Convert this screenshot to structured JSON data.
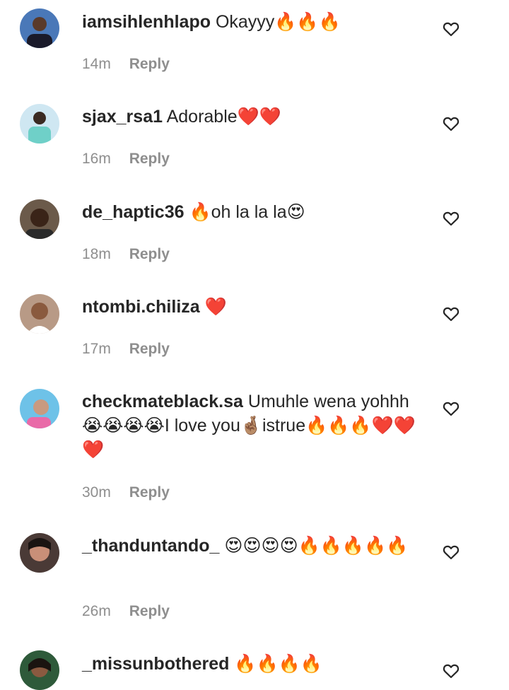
{
  "comments": [
    {
      "username": "iamsihlenhlapo",
      "text": "Okayyy🔥🔥🔥",
      "time": "14m",
      "reply": "Reply"
    },
    {
      "username": "sjax_rsa1",
      "text": "Adorable❤️❤️",
      "time": "16m",
      "reply": "Reply"
    },
    {
      "username": "de_haptic36",
      "text": "🔥oh la la la😍",
      "time": "18m",
      "reply": "Reply"
    },
    {
      "username": "ntombi.chiliza",
      "text": "❤️",
      "time": "17m",
      "reply": "Reply"
    },
    {
      "username": "checkmateblack.sa",
      "text": "Umuhle wena yohhh😭😭😭😭I love you🤞🏽istrue🔥🔥🔥❤️❤️❤️",
      "time": "30m",
      "reply": "Reply"
    },
    {
      "username": "_thanduntando_",
      "text": "😍😍😍😍🔥🔥🔥🔥🔥",
      "time": "26m",
      "reply": "Reply"
    },
    {
      "username": "_missunbothered",
      "text": "🔥🔥🔥🔥",
      "time": "",
      "reply": ""
    }
  ],
  "icons": {
    "like": "heart-outline-icon"
  },
  "colors": {
    "text": "#262626",
    "secondary": "#8e8e8e",
    "background": "#ffffff"
  }
}
